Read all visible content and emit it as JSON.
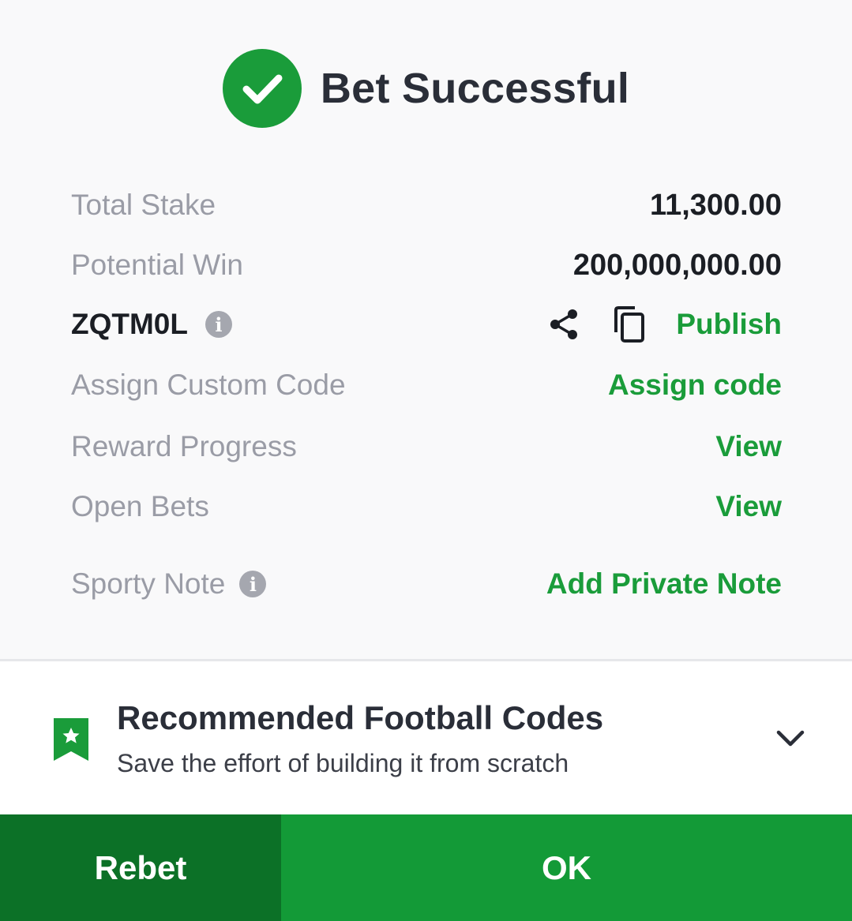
{
  "header": {
    "title": "Bet Successful",
    "icon": "check-circle-icon",
    "accent": "#1a9c3a"
  },
  "summary": {
    "total_stake_label": "Total Stake",
    "total_stake_value": "11,300.00",
    "potential_win_label": "Potential Win",
    "potential_win_value": "200,000,000.00",
    "booking_code": "ZQTM0L",
    "publish_label": "Publish",
    "assign_custom_code_label": "Assign Custom Code",
    "assign_code_action": "Assign code",
    "reward_progress_label": "Reward Progress",
    "reward_progress_action": "View",
    "open_bets_label": "Open Bets",
    "open_bets_action": "View",
    "sporty_note_label": "Sporty Note",
    "sporty_note_action": "Add Private Note"
  },
  "recommended": {
    "title": "Recommended Football Codes",
    "subtitle": "Save the effort of building it from scratch"
  },
  "footer": {
    "rebet_label": "Rebet",
    "ok_label": "OK"
  }
}
